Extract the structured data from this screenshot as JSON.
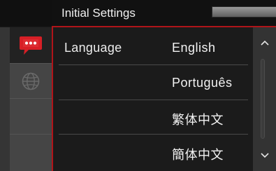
{
  "header": {
    "title": "Initial Settings"
  },
  "sidebar": {
    "tabs": [
      {
        "icon": "chat-bubble-icon",
        "active": true
      },
      {
        "icon": "globe-icon",
        "active": false
      }
    ]
  },
  "settings": {
    "label": "Language",
    "options": [
      "English",
      "Português",
      "繁体中文",
      "簡体中文"
    ]
  },
  "scrollbar": {
    "up_glyph": "^",
    "down_glyph": "v"
  },
  "colors": {
    "accent": "#b01419",
    "background": "#1b1b1b",
    "sidebar": "#454545",
    "text": "#f0f0f0"
  }
}
